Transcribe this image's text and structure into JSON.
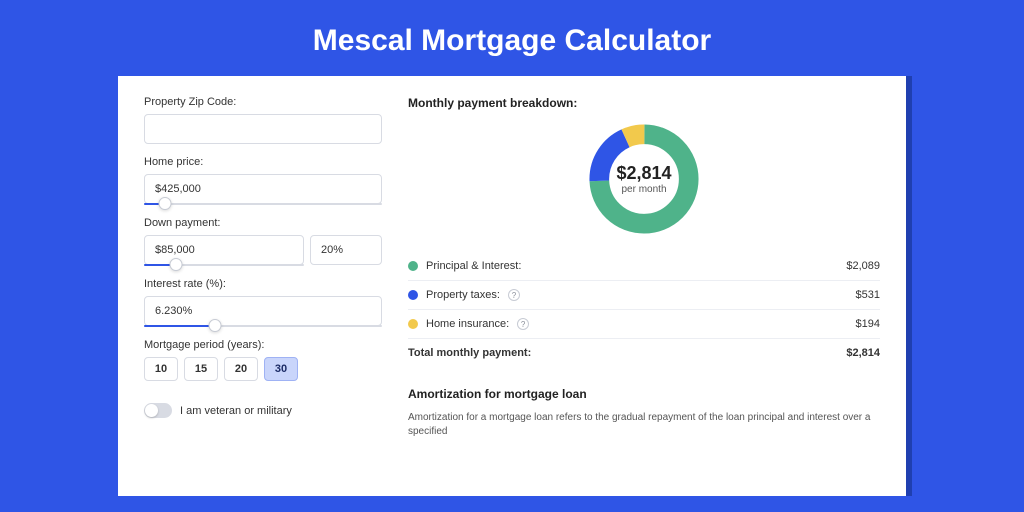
{
  "title": "Mescal Mortgage Calculator",
  "form": {
    "zip_label": "Property Zip Code:",
    "zip_value": "",
    "home_price_label": "Home price:",
    "home_price_value": "$425,000",
    "home_price_slider_pct": 9,
    "down_payment_label": "Down payment:",
    "down_payment_value": "$85,000",
    "down_payment_pct_value": "20%",
    "down_payment_slider_pct": 20,
    "interest_label": "Interest rate (%):",
    "interest_value": "6.230%",
    "interest_slider_pct": 30,
    "period_label": "Mortgage period (years):",
    "periods": [
      "10",
      "15",
      "20",
      "30"
    ],
    "period_active_index": 3,
    "veteran_label": "I am veteran or military"
  },
  "breakdown": {
    "title": "Monthly payment breakdown:",
    "donut_value": "$2,814",
    "donut_sub": "per month",
    "items": [
      {
        "label": "Principal & Interest:",
        "value": "$2,089",
        "color": "#4fb38a",
        "has_info": false
      },
      {
        "label": "Property taxes:",
        "value": "$531",
        "color": "#2f55e6",
        "has_info": true
      },
      {
        "label": "Home insurance:",
        "value": "$194",
        "color": "#f2c94c",
        "has_info": true
      }
    ],
    "total_label": "Total monthly payment:",
    "total_value": "$2,814"
  },
  "chart_data": {
    "type": "pie",
    "title": "Monthly payment breakdown",
    "categories": [
      "Principal & Interest",
      "Property taxes",
      "Home insurance"
    ],
    "values": [
      2089,
      531,
      194
    ],
    "colors": [
      "#4fb38a",
      "#2f55e6",
      "#f2c94c"
    ],
    "total": 2814
  },
  "amort": {
    "title": "Amortization for mortgage loan",
    "text": "Amortization for a mortgage loan refers to the gradual repayment of the loan principal and interest over a specified"
  }
}
